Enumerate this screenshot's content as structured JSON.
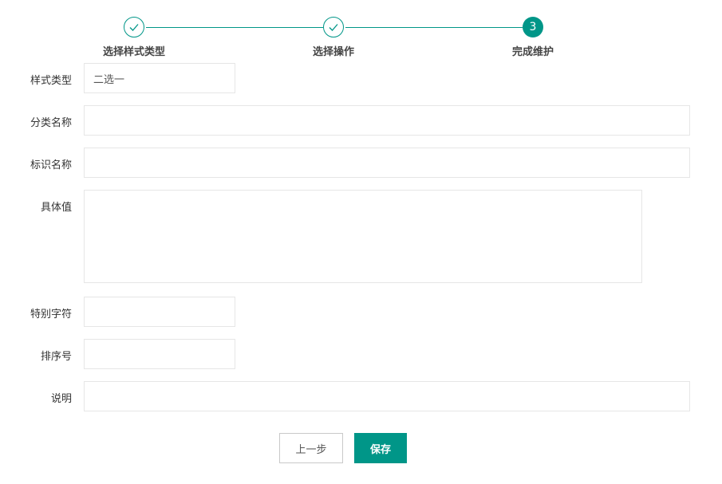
{
  "steps": [
    {
      "label": "选择样式类型",
      "status": "done"
    },
    {
      "label": "选择操作",
      "status": "done"
    },
    {
      "label": "完成维护",
      "status": "active",
      "number": "3"
    }
  ],
  "form": {
    "style_type": {
      "label": "样式类型",
      "value": "二选一"
    },
    "category_name": {
      "label": "分类名称",
      "value": ""
    },
    "identifier_name": {
      "label": "标识名称",
      "value": ""
    },
    "specific_value": {
      "label": "具体值",
      "value": ""
    },
    "special_char": {
      "label": "特别字符",
      "value": ""
    },
    "sort_number": {
      "label": "排序号",
      "value": ""
    },
    "description": {
      "label": "说明",
      "value": ""
    }
  },
  "buttons": {
    "prev": "上一步",
    "save": "保存"
  },
  "colors": {
    "accent": "#009688",
    "border": "#e6e6e6"
  }
}
